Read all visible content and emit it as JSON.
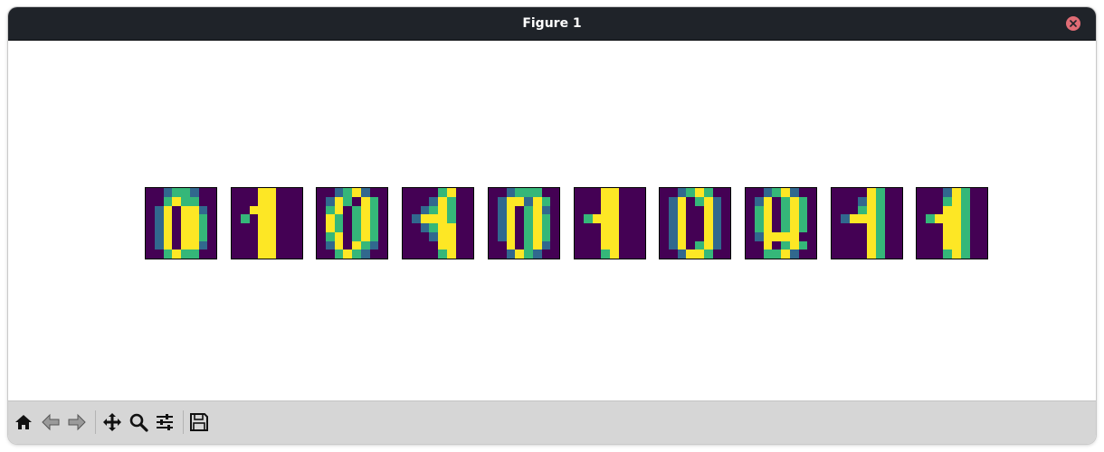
{
  "window": {
    "title": "Figure 1"
  },
  "figure": {
    "digit_labels": [
      "0",
      "1",
      "0",
      "1",
      "0",
      "1",
      "0",
      "0",
      "1",
      "1"
    ],
    "colormap": "viridis",
    "images": [
      [
        "00122100",
        "00232200",
        "01303310",
        "01303320",
        "01303320",
        "01303320",
        "01303310",
        "00232200"
      ],
      [
        "00033000",
        "00033000",
        "00333000",
        "02033000",
        "00033000",
        "00033000",
        "00033000",
        "00033000"
      ],
      [
        "00123100",
        "01320320",
        "02302320",
        "03202320",
        "03202320",
        "02302320",
        "01303210",
        "00232100"
      ],
      [
        "00002300",
        "00013200",
        "00123200",
        "01333200",
        "00123300",
        "00013300",
        "00003300",
        "00002300"
      ],
      [
        "00122200",
        "01331320",
        "01302310",
        "01302320",
        "01302320",
        "01302320",
        "00302310",
        "00132100"
      ],
      [
        "00033000",
        "00033000",
        "00033000",
        "02333000",
        "00033000",
        "00033000",
        "00033000",
        "00023000"
      ],
      [
        "00123200",
        "01302310",
        "01300310",
        "01300310",
        "01300310",
        "01300310",
        "01302310",
        "00133200"
      ],
      [
        "00123100",
        "01302320",
        "02302320",
        "02302320",
        "02302320",
        "01333300",
        "00302320",
        "00223100"
      ],
      [
        "00003200",
        "00013200",
        "00023200",
        "01333200",
        "00003200",
        "00003200",
        "00003200",
        "00003200"
      ],
      [
        "00013200",
        "00023200",
        "00033200",
        "02333200",
        "00033200",
        "00033200",
        "00033200",
        "00023200"
      ]
    ],
    "palette": [
      "#440154",
      "#31688e",
      "#35b779",
      "#fde725"
    ]
  },
  "toolbar": {
    "buttons": [
      {
        "name": "home-button",
        "icon": "home-icon"
      },
      {
        "name": "back-button",
        "icon": "arrow-left-icon"
      },
      {
        "name": "forward-button",
        "icon": "arrow-right-icon"
      },
      {
        "name": "pan-button",
        "icon": "move-icon"
      },
      {
        "name": "zoom-button",
        "icon": "magnifier-icon"
      },
      {
        "name": "configure-subplots-button",
        "icon": "sliders-icon"
      },
      {
        "name": "save-button",
        "icon": "floppy-disk-icon"
      }
    ]
  }
}
